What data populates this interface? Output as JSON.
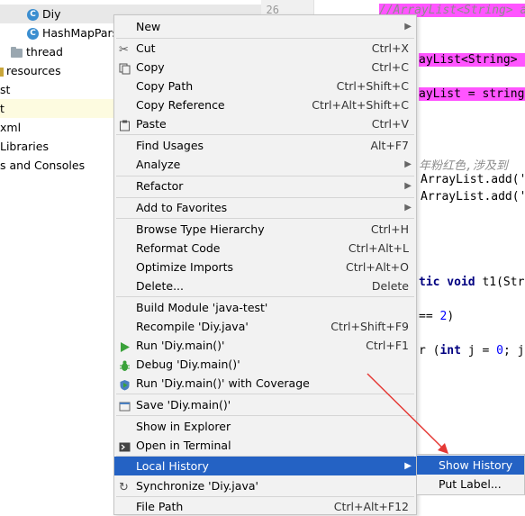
{
  "tree": {
    "items": [
      {
        "label": "Diy",
        "icon": "class-icon"
      },
      {
        "label": "HashMapPars",
        "icon": "class-icon"
      },
      {
        "label": "thread",
        "icon": "folder-icon"
      },
      {
        "label": "resources",
        "icon": "resources-folder-icon"
      },
      {
        "label": "st"
      },
      {
        "label": "t"
      },
      {
        "label": "xml"
      },
      {
        "label": "Libraries"
      },
      {
        "label": "s and Consoles"
      }
    ]
  },
  "editor": {
    "line_number": "26",
    "lines": [
      "//ArrayList<String> a",
      "ayList<String> a",
      "ayList = string",
      "年粉红色,涉及到",
      "ArrayList.add('",
      "ArrayList.add('",
      "tic void t1(Str",
      "== 2)",
      "r (int j = 0; j"
    ]
  },
  "menu": {
    "new": {
      "label": "New"
    },
    "cut": {
      "label": "Cut",
      "shortcut": "Ctrl+X"
    },
    "copy": {
      "label": "Copy",
      "shortcut": "Ctrl+C"
    },
    "copy_path": {
      "label": "Copy Path",
      "shortcut": "Ctrl+Shift+C"
    },
    "copy_reference": {
      "label": "Copy Reference",
      "shortcut": "Ctrl+Alt+Shift+C"
    },
    "paste": {
      "label": "Paste",
      "shortcut": "Ctrl+V"
    },
    "find_usages": {
      "label": "Find Usages",
      "shortcut": "Alt+F7"
    },
    "analyze": {
      "label": "Analyze"
    },
    "refactor": {
      "label": "Refactor"
    },
    "add_to_favorites": {
      "label": "Add to Favorites"
    },
    "browse_type_hierarchy": {
      "label": "Browse Type Hierarchy",
      "shortcut": "Ctrl+H"
    },
    "reformat_code": {
      "label": "Reformat Code",
      "shortcut": "Ctrl+Alt+L"
    },
    "optimize_imports": {
      "label": "Optimize Imports",
      "shortcut": "Ctrl+Alt+O"
    },
    "delete": {
      "label": "Delete...",
      "shortcut": "Delete"
    },
    "build_module": {
      "label": "Build Module 'java-test'"
    },
    "recompile": {
      "label": "Recompile 'Diy.java'",
      "shortcut": "Ctrl+Shift+F9"
    },
    "run": {
      "label": "Run 'Diy.main()'",
      "shortcut": "Ctrl+F1"
    },
    "debug": {
      "label": "Debug 'Diy.main()'"
    },
    "run_coverage": {
      "label": "Run 'Diy.main()' with Coverage"
    },
    "save": {
      "label": "Save 'Diy.main()'"
    },
    "show_in_explorer": {
      "label": "Show in Explorer"
    },
    "open_in_terminal": {
      "label": "Open in Terminal"
    },
    "local_history": {
      "label": "Local History"
    },
    "synchronize": {
      "label": "Synchronize 'Diy.java'"
    },
    "file_path": {
      "label": "File Path",
      "shortcut": "Ctrl+Alt+F12"
    }
  },
  "submenu": {
    "show_history": {
      "label": "Show History"
    },
    "put_label": {
      "label": "Put Label..."
    }
  },
  "colors": {
    "menu_bg": "#f2f2f2",
    "selection": "#2462c4",
    "code_highlight": "#ff55ff",
    "annotation_arrow": "#e53935"
  }
}
